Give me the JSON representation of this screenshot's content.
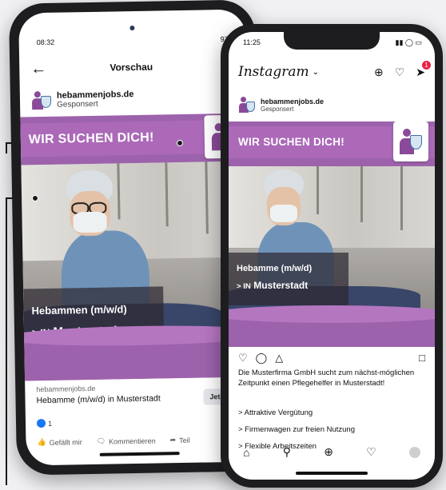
{
  "facebook_preview": {
    "status_time": "08:32",
    "status_battery": "97%",
    "back_icon": "arrow-left-icon",
    "title": "Vorschau",
    "advertiser": "hebammenjobs.de",
    "sponsored": "Gesponsert",
    "ad": {
      "banner": "WIR SUCHEN DICH!",
      "job_title": "Hebammen (m/w/d)",
      "location_prefix": "> IN",
      "location": "Musterstadt"
    },
    "link_domain": "hebammenjobs.de",
    "link_headline": "Hebamme (m/w/d) in Musterstadt",
    "cta": "Jetzt bewer",
    "likes_count": "1",
    "actions": [
      "Gefällt mir",
      "Kommentieren",
      "Teil"
    ]
  },
  "instagram": {
    "status_time": "11:25",
    "logo": "Instagram",
    "notification_count": "1",
    "advertiser": "hebammenjobs.de",
    "sponsored": "Gesponsert",
    "ad": {
      "banner": "WIR SUCHEN DICH!",
      "job_title": "Hebamme (m/w/d)",
      "location_prefix": "> IN",
      "location": "Musterstadt"
    },
    "caption": "Die Musterfirma GmbH sucht zum nächst-möglichen Zeitpunkt einen Pflegehelfer in Musterstadt!",
    "benefits": [
      "> Attraktive Vergütung",
      "> Firmenwagen zur freien Nutzung",
      "> Flexible Arbeitszeiten"
    ],
    "nav_icons": [
      "home-icon",
      "search-icon",
      "add-icon",
      "heart-icon",
      "profile-icon"
    ]
  },
  "colors": {
    "brand_purple": "#9d62ac",
    "banner_purple": "#ab69b8",
    "facebook_blue": "#1877f2",
    "instagram_badge": "#ed2146"
  }
}
